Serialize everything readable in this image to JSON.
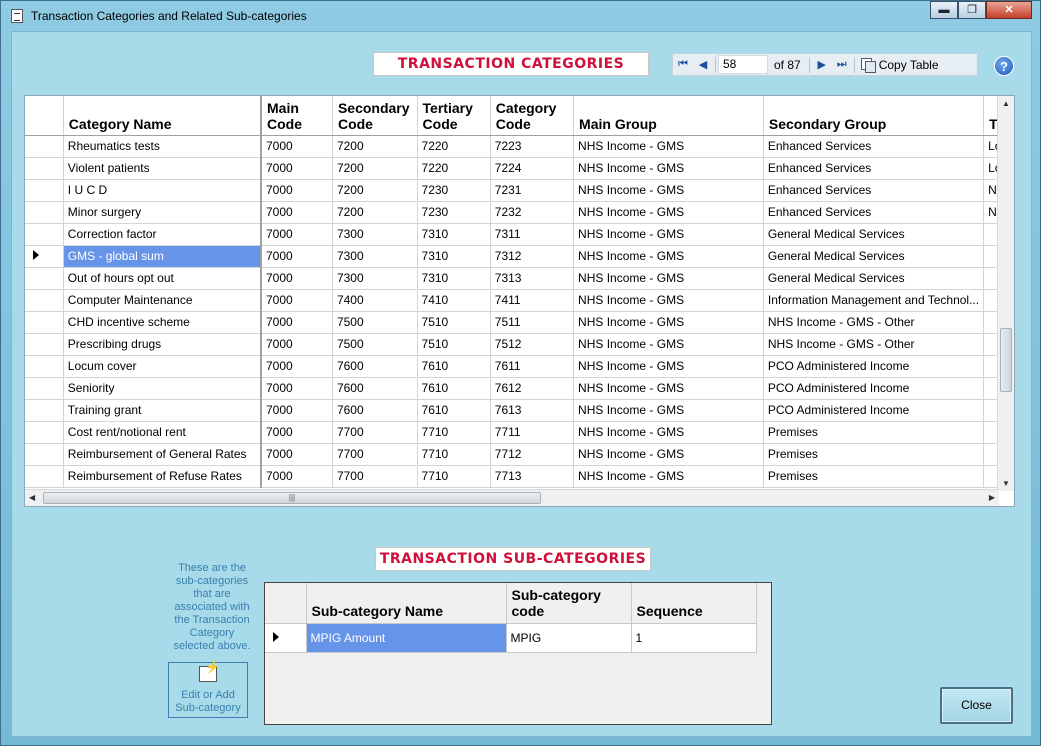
{
  "window": {
    "title": "Transaction Categories and Related Sub-categories",
    "buttons": {
      "minimize": "▬",
      "maximize": "❐",
      "close": "✕"
    }
  },
  "categories_heading": "TRANSACTION CATEGORIES",
  "nav": {
    "position": "58",
    "of": "of 87",
    "copy_label": "Copy Table"
  },
  "help": "?",
  "main_table": {
    "columns": [
      "Category Name",
      "Main Code",
      "Secondary Code",
      "Tertiary Code",
      "Category Code",
      "Main Group",
      "Secondary Group",
      "T..."
    ],
    "columns_wrapped": {
      "main_code": [
        "Main",
        "Code"
      ],
      "secondary_code": [
        "Secondary",
        "Code"
      ],
      "tertiary_code": [
        "Tertiary",
        "Code"
      ],
      "category_code": [
        "Category",
        "Code"
      ]
    },
    "rows": [
      {
        "name": "Rheumatics tests",
        "main": "7000",
        "secondary": "7200",
        "tertiary": "7220",
        "category": "7223",
        "main_group": "NHS Income - GMS",
        "secondary_group": "Enhanced Services",
        "extra": "Lo"
      },
      {
        "name": "Violent patients",
        "main": "7000",
        "secondary": "7200",
        "tertiary": "7220",
        "category": "7224",
        "main_group": "NHS Income - GMS",
        "secondary_group": "Enhanced Services",
        "extra": "Lo"
      },
      {
        "name": "I U C D",
        "main": "7000",
        "secondary": "7200",
        "tertiary": "7230",
        "category": "7231",
        "main_group": "NHS Income - GMS",
        "secondary_group": "Enhanced Services",
        "extra": "N"
      },
      {
        "name": "Minor surgery",
        "main": "7000",
        "secondary": "7200",
        "tertiary": "7230",
        "category": "7232",
        "main_group": "NHS Income - GMS",
        "secondary_group": "Enhanced Services",
        "extra": "N"
      },
      {
        "name": "Correction factor",
        "main": "7000",
        "secondary": "7300",
        "tertiary": "7310",
        "category": "7311",
        "main_group": "NHS Income - GMS",
        "secondary_group": "General Medical Services",
        "extra": ""
      },
      {
        "name": "GMS - global sum",
        "main": "7000",
        "secondary": "7300",
        "tertiary": "7310",
        "category": "7312",
        "main_group": "NHS Income - GMS",
        "secondary_group": "General Medical Services",
        "extra": ""
      },
      {
        "name": "Out of hours opt out",
        "main": "7000",
        "secondary": "7300",
        "tertiary": "7310",
        "category": "7313",
        "main_group": "NHS Income - GMS",
        "secondary_group": "General Medical Services",
        "extra": ""
      },
      {
        "name": "Computer Maintenance",
        "main": "7000",
        "secondary": "7400",
        "tertiary": "7410",
        "category": "7411",
        "main_group": "NHS Income - GMS",
        "secondary_group": "Information Management and Technol...",
        "extra": ""
      },
      {
        "name": "CHD incentive scheme",
        "main": "7000",
        "secondary": "7500",
        "tertiary": "7510",
        "category": "7511",
        "main_group": "NHS Income - GMS",
        "secondary_group": "NHS Income - GMS - Other",
        "extra": ""
      },
      {
        "name": "Prescribing drugs",
        "main": "7000",
        "secondary": "7500",
        "tertiary": "7510",
        "category": "7512",
        "main_group": "NHS Income - GMS",
        "secondary_group": "NHS Income - GMS - Other",
        "extra": ""
      },
      {
        "name": "Locum cover",
        "main": "7000",
        "secondary": "7600",
        "tertiary": "7610",
        "category": "7611",
        "main_group": "NHS Income - GMS",
        "secondary_group": "PCO Administered Income",
        "extra": ""
      },
      {
        "name": "Seniority",
        "main": "7000",
        "secondary": "7600",
        "tertiary": "7610",
        "category": "7612",
        "main_group": "NHS Income - GMS",
        "secondary_group": "PCO Administered Income",
        "extra": ""
      },
      {
        "name": "Training grant",
        "main": "7000",
        "secondary": "7600",
        "tertiary": "7610",
        "category": "7613",
        "main_group": "NHS Income - GMS",
        "secondary_group": "PCO Administered Income",
        "extra": ""
      },
      {
        "name": "Cost rent/notional rent",
        "main": "7000",
        "secondary": "7700",
        "tertiary": "7710",
        "category": "7711",
        "main_group": "NHS Income - GMS",
        "secondary_group": "Premises",
        "extra": ""
      },
      {
        "name": "Reimbursement of General Rates",
        "main": "7000",
        "secondary": "7700",
        "tertiary": "7710",
        "category": "7712",
        "main_group": "NHS Income - GMS",
        "secondary_group": "Premises",
        "extra": ""
      },
      {
        "name": "Reimbursement of Refuse Rates",
        "main": "7000",
        "secondary": "7700",
        "tertiary": "7710",
        "category": "7713",
        "main_group": "NHS Income - GMS",
        "secondary_group": "Premises",
        "extra": ""
      }
    ],
    "selected_index": 5
  },
  "subcategories_heading": "TRANSACTION SUB-CATEGORIES",
  "note": "These are the sub-categories that are associated with the Transaction Category selected above.",
  "edit_button": "Edit or Add Sub-category",
  "sub_table": {
    "columns": [
      "Sub-category Name",
      "Sub-category code",
      "Sequence"
    ],
    "rows": [
      {
        "name": "MPIG Amount",
        "code": "MPIG",
        "sequence": "1"
      }
    ]
  },
  "close_button": "Close",
  "colors": {
    "selection": "#6694e8",
    "heading_text": "#d0103a",
    "client_bg": "#a8dbe9"
  }
}
